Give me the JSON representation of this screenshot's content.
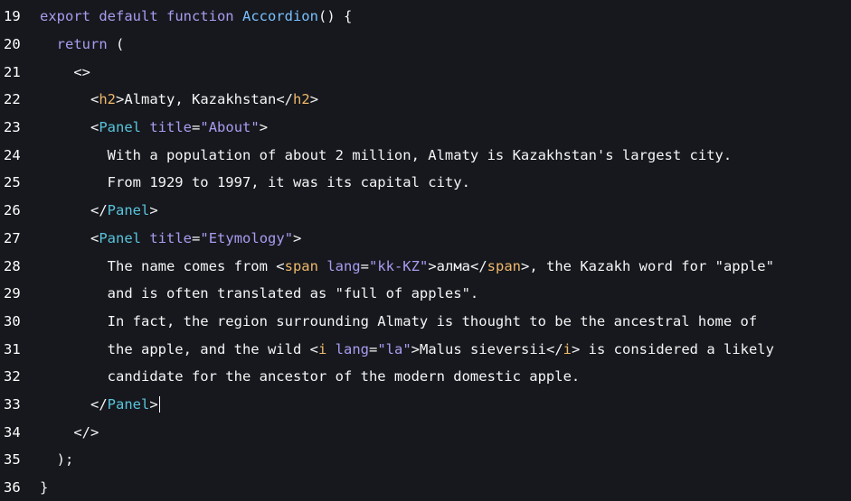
{
  "lines": [
    {
      "n": "19",
      "indent": "",
      "tokens": [
        {
          "t": "export ",
          "c": "kw"
        },
        {
          "t": "default ",
          "c": "kw"
        },
        {
          "t": "function ",
          "c": "kw"
        },
        {
          "t": "Accordion",
          "c": "fn"
        },
        {
          "t": "() {",
          "c": "punct"
        }
      ]
    },
    {
      "n": "20",
      "indent": "  ",
      "tokens": [
        {
          "t": "return ",
          "c": "kw"
        },
        {
          "t": "(",
          "c": "punct"
        }
      ]
    },
    {
      "n": "21",
      "indent": "    ",
      "tokens": [
        {
          "t": "<>",
          "c": "punct"
        }
      ]
    },
    {
      "n": "22",
      "indent": "      ",
      "tokens": [
        {
          "t": "<",
          "c": "punct"
        },
        {
          "t": "h2",
          "c": "tag"
        },
        {
          "t": ">",
          "c": "punct"
        },
        {
          "t": "Almaty, Kazakhstan",
          "c": "plain"
        },
        {
          "t": "</",
          "c": "punct"
        },
        {
          "t": "h2",
          "c": "tag"
        },
        {
          "t": ">",
          "c": "punct"
        }
      ]
    },
    {
      "n": "23",
      "indent": "      ",
      "tokens": [
        {
          "t": "<",
          "c": "punct"
        },
        {
          "t": "Panel",
          "c": "comp"
        },
        {
          "t": " ",
          "c": "plain"
        },
        {
          "t": "title",
          "c": "attr"
        },
        {
          "t": "=",
          "c": "punct"
        },
        {
          "t": "\"About\"",
          "c": "str"
        },
        {
          "t": ">",
          "c": "punct"
        }
      ]
    },
    {
      "n": "24",
      "indent": "        ",
      "tokens": [
        {
          "t": "With a population of about 2 million, Almaty is Kazakhstan's largest city.",
          "c": "plain"
        }
      ]
    },
    {
      "n": "25",
      "indent": "        ",
      "tokens": [
        {
          "t": "From 1929 to 1997, it was its capital city.",
          "c": "plain"
        }
      ]
    },
    {
      "n": "26",
      "indent": "      ",
      "tokens": [
        {
          "t": "</",
          "c": "punct"
        },
        {
          "t": "Panel",
          "c": "comp"
        },
        {
          "t": ">",
          "c": "punct"
        }
      ]
    },
    {
      "n": "27",
      "indent": "      ",
      "tokens": [
        {
          "t": "<",
          "c": "punct"
        },
        {
          "t": "Panel",
          "c": "comp"
        },
        {
          "t": " ",
          "c": "plain"
        },
        {
          "t": "title",
          "c": "attr"
        },
        {
          "t": "=",
          "c": "punct"
        },
        {
          "t": "\"Etymology\"",
          "c": "str"
        },
        {
          "t": ">",
          "c": "punct"
        }
      ]
    },
    {
      "n": "28",
      "indent": "        ",
      "tokens": [
        {
          "t": "The name comes from ",
          "c": "plain"
        },
        {
          "t": "<",
          "c": "punct"
        },
        {
          "t": "span",
          "c": "tag"
        },
        {
          "t": " ",
          "c": "plain"
        },
        {
          "t": "lang",
          "c": "attr"
        },
        {
          "t": "=",
          "c": "punct"
        },
        {
          "t": "\"kk-KZ\"",
          "c": "str"
        },
        {
          "t": ">",
          "c": "punct"
        },
        {
          "t": "алма",
          "c": "plain"
        },
        {
          "t": "</",
          "c": "punct"
        },
        {
          "t": "span",
          "c": "tag"
        },
        {
          "t": ">",
          "c": "punct"
        },
        {
          "t": ", the Kazakh word for \"apple\"",
          "c": "plain"
        }
      ]
    },
    {
      "n": "29",
      "indent": "        ",
      "tokens": [
        {
          "t": "and is often translated as \"full of apples\".",
          "c": "plain"
        }
      ]
    },
    {
      "n": "30",
      "indent": "        ",
      "tokens": [
        {
          "t": "In fact, the region surrounding Almaty is thought to be the ancestral home of",
          "c": "plain"
        }
      ]
    },
    {
      "n": "31",
      "indent": "        ",
      "tokens": [
        {
          "t": "the apple, and the wild ",
          "c": "plain"
        },
        {
          "t": "<",
          "c": "punct"
        },
        {
          "t": "i",
          "c": "tag"
        },
        {
          "t": " ",
          "c": "plain"
        },
        {
          "t": "lang",
          "c": "attr"
        },
        {
          "t": "=",
          "c": "punct"
        },
        {
          "t": "\"la\"",
          "c": "str"
        },
        {
          "t": ">",
          "c": "punct"
        },
        {
          "t": "Malus sieversii",
          "c": "plain"
        },
        {
          "t": "</",
          "c": "punct"
        },
        {
          "t": "i",
          "c": "tag"
        },
        {
          "t": ">",
          "c": "punct"
        },
        {
          "t": " is considered a likely",
          "c": "plain"
        }
      ]
    },
    {
      "n": "32",
      "indent": "        ",
      "tokens": [
        {
          "t": "candidate for the ancestor of the modern domestic apple.",
          "c": "plain"
        }
      ]
    },
    {
      "n": "33",
      "indent": "      ",
      "cursor": true,
      "tokens": [
        {
          "t": "</",
          "c": "punct"
        },
        {
          "t": "Panel",
          "c": "comp"
        },
        {
          "t": ">",
          "c": "punct"
        }
      ]
    },
    {
      "n": "34",
      "indent": "    ",
      "tokens": [
        {
          "t": "</>",
          "c": "punct"
        }
      ]
    },
    {
      "n": "35",
      "indent": "  ",
      "tokens": [
        {
          "t": ");",
          "c": "punct"
        }
      ]
    },
    {
      "n": "36",
      "indent": "",
      "tokens": [
        {
          "t": "}",
          "c": "punct"
        }
      ]
    }
  ]
}
